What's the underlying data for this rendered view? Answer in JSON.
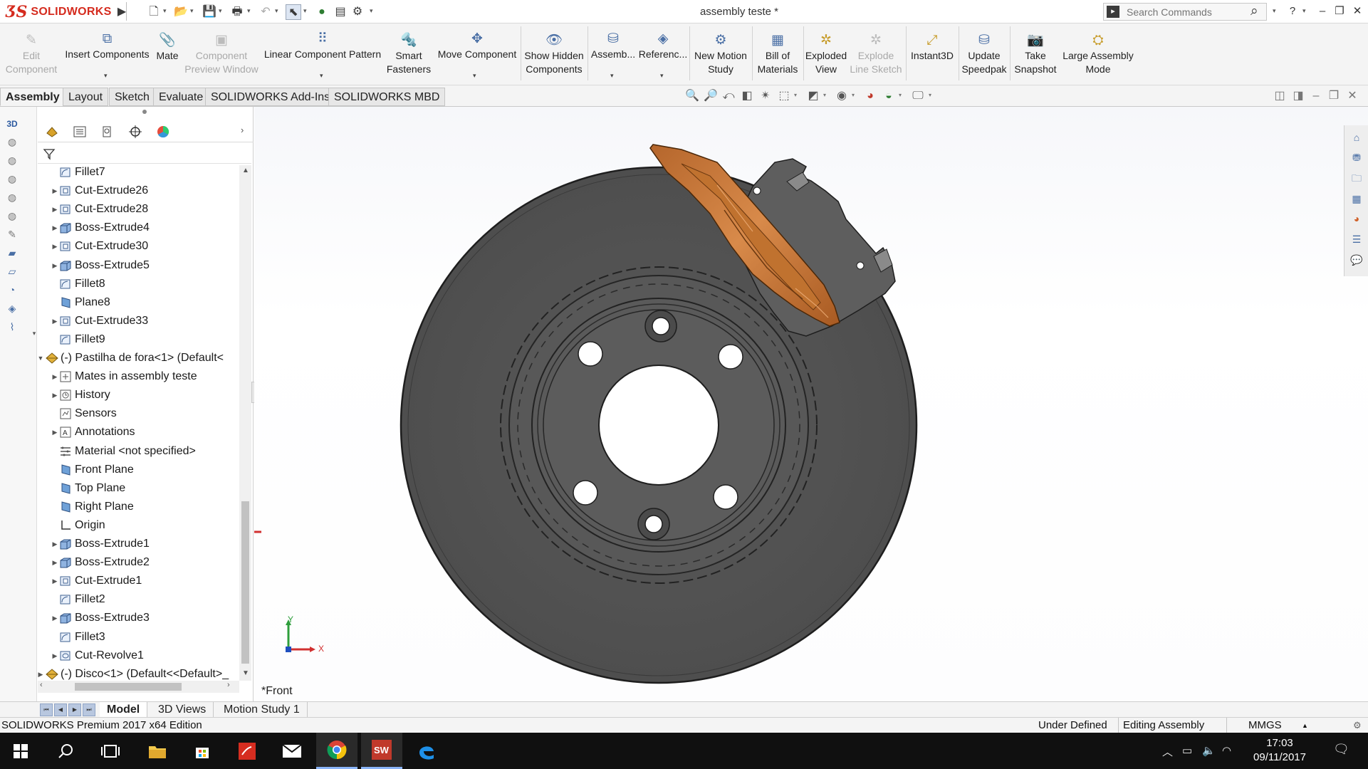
{
  "title_bar": {
    "logo_text": "SOLIDWORKS",
    "document_title": "assembly teste *",
    "search_placeholder": "Search Commands",
    "help_label": "?"
  },
  "command_manager": {
    "edit_component": "Edit\nComponent",
    "insert_components": "Insert Components",
    "mate": "Mate",
    "component_preview_window": "Component\nPreview Window",
    "linear_component_pattern": "Linear Component Pattern",
    "smart_fasteners": "Smart\nFasteners",
    "move_component": "Move Component",
    "show_hidden_components": "Show Hidden\nComponents",
    "assembly_features": "Assemb...",
    "reference_geometry": "Referenc...",
    "new_motion_study": "New Motion\nStudy",
    "bill_of_materials": "Bill of\nMaterials",
    "exploded_view": "Exploded\nView",
    "explode_line_sketch": "Explode\nLine Sketch",
    "instant3d": "Instant3D",
    "update_speedpak": "Update\nSpeedpak",
    "take_snapshot": "Take\nSnapshot",
    "large_assembly_mode": "Large Assembly\nMode"
  },
  "ribbon_tabs": [
    "Assembly",
    "Layout",
    "Sketch",
    "Evaluate",
    "SOLIDWORKS Add-Ins",
    "SOLIDWORKS MBD"
  ],
  "feature_tree": {
    "rows": [
      {
        "label": "Fillet7",
        "expandable": false,
        "icon": "fillet-icon",
        "indent": 1
      },
      {
        "label": "Cut-Extrude26",
        "expandable": true,
        "icon": "cut-extrude-icon",
        "indent": 1
      },
      {
        "label": "Cut-Extrude28",
        "expandable": true,
        "icon": "cut-extrude-icon",
        "indent": 1
      },
      {
        "label": "Boss-Extrude4",
        "expandable": true,
        "icon": "boss-extrude-icon",
        "indent": 1
      },
      {
        "label": "Cut-Extrude30",
        "expandable": true,
        "icon": "cut-extrude-icon",
        "indent": 1
      },
      {
        "label": "Boss-Extrude5",
        "expandable": true,
        "icon": "boss-extrude-icon",
        "indent": 1
      },
      {
        "label": "Fillet8",
        "expandable": false,
        "icon": "fillet-icon",
        "indent": 1
      },
      {
        "label": "Plane8",
        "expandable": false,
        "icon": "plane-icon",
        "indent": 1
      },
      {
        "label": "Cut-Extrude33",
        "expandable": true,
        "icon": "cut-extrude-icon",
        "indent": 1
      },
      {
        "label": "Fillet9",
        "expandable": false,
        "icon": "fillet-icon",
        "indent": 1
      },
      {
        "label": "(-) Pastilha  de fora<1> (Default<",
        "expandable": true,
        "expanded": true,
        "icon": "part-icon",
        "indent": 0
      },
      {
        "label": "Mates in assembly teste",
        "expandable": true,
        "icon": "mates-icon",
        "indent": 1
      },
      {
        "label": "History",
        "expandable": true,
        "icon": "history-icon",
        "indent": 1
      },
      {
        "label": "Sensors",
        "expandable": false,
        "icon": "sensors-icon",
        "indent": 1
      },
      {
        "label": "Annotations",
        "expandable": true,
        "icon": "annotations-icon",
        "indent": 1
      },
      {
        "label": "Material <not specified>",
        "expandable": false,
        "icon": "material-icon",
        "indent": 1
      },
      {
        "label": "Front Plane",
        "expandable": false,
        "icon": "plane-icon",
        "indent": 1
      },
      {
        "label": "Top Plane",
        "expandable": false,
        "icon": "plane-icon",
        "indent": 1
      },
      {
        "label": "Right Plane",
        "expandable": false,
        "icon": "plane-icon",
        "indent": 1
      },
      {
        "label": "Origin",
        "expandable": false,
        "icon": "origin-icon",
        "indent": 1
      },
      {
        "label": "Boss-Extrude1",
        "expandable": true,
        "icon": "boss-extrude-icon",
        "indent": 1
      },
      {
        "label": "Boss-Extrude2",
        "expandable": true,
        "icon": "boss-extrude-icon",
        "indent": 1
      },
      {
        "label": "Cut-Extrude1",
        "expandable": true,
        "icon": "cut-extrude-icon",
        "indent": 1
      },
      {
        "label": "Fillet2",
        "expandable": false,
        "icon": "fillet-icon",
        "indent": 1
      },
      {
        "label": "Boss-Extrude3",
        "expandable": true,
        "icon": "boss-extrude-icon",
        "indent": 1
      },
      {
        "label": "Fillet3",
        "expandable": false,
        "icon": "fillet-icon",
        "indent": 1
      },
      {
        "label": "Cut-Revolve1",
        "expandable": true,
        "icon": "revolve-icon",
        "indent": 1
      },
      {
        "label": "(-) Disco<1> (Default<<Default>_",
        "expandable": true,
        "expanded": false,
        "icon": "part-icon",
        "indent": 0
      }
    ]
  },
  "graphics_area": {
    "view_label": "*Front",
    "triad_x": "X",
    "triad_y": "Y",
    "colors": {
      "disc": "#555555",
      "disc_edge": "#1f1f1f",
      "caliper": "#c8753a",
      "bracket": "#8a8a8a"
    }
  },
  "bottom_tabs": [
    "Model",
    "3D Views",
    "Motion Study 1"
  ],
  "status_bar": {
    "edition": "SOLIDWORKS Premium 2017 x64 Edition",
    "state": "Under Defined",
    "mode": "Editing Assembly",
    "units": "MMGS"
  },
  "taskbar": {
    "time": "17:03",
    "date": "09/11/2017",
    "apps": [
      "windows-start-icon",
      "search-icon",
      "task-view-icon",
      "file-explorer-icon",
      "store-icon",
      "acrobat-icon",
      "mail-icon",
      "chrome-icon",
      "solidworks-icon",
      "edge-icon"
    ]
  }
}
